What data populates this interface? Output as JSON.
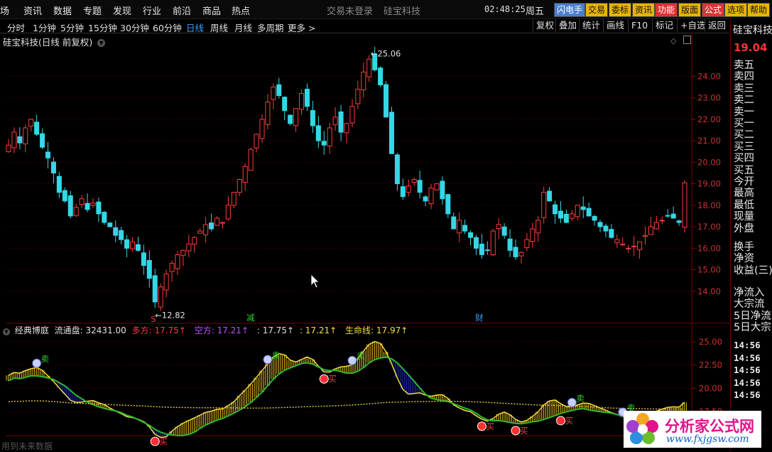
{
  "menubar": {
    "items": [
      "场",
      "资讯",
      "数据",
      "专题",
      "发现",
      "行业",
      "前沿",
      "商品",
      "热点"
    ],
    "center": [
      "交易未登录",
      "硅宝科技"
    ],
    "clock": "02:48:25",
    "weekday": "周五",
    "tabs": [
      {
        "label": "闪电手",
        "bg": "#4a7fd0",
        "fg": "#ffffff"
      },
      {
        "label": "交易",
        "bg": "#e8b400",
        "fg": "#111111"
      },
      {
        "label": "委标",
        "bg": "#e8b400",
        "fg": "#111111"
      },
      {
        "label": "资讯",
        "bg": "#e8b400",
        "fg": "#111111"
      },
      {
        "label": "功能",
        "bg": "#d33",
        "fg": "#ffffff"
      },
      {
        "label": "版面",
        "bg": "#e8b400",
        "fg": "#111111"
      },
      {
        "label": "公式",
        "bg": "#d33",
        "fg": "#ffffff"
      },
      {
        "label": "选项",
        "bg": "#e8b400",
        "fg": "#111111"
      },
      {
        "label": "帮助",
        "bg": "#e8b400",
        "fg": "#111111"
      }
    ]
  },
  "periods": {
    "items": [
      "分时",
      "1分钟",
      "5分钟",
      "15分钟",
      "30分钟",
      "60分钟",
      "日线",
      "周线",
      "月线",
      "多周期",
      "更多 >"
    ],
    "active": "日线"
  },
  "tools": [
    "复权",
    "叠加",
    "统计",
    "画线",
    "F10",
    "标记",
    "+自选",
    "返回"
  ],
  "chart_title": "硅宝科技(日线 前复权)",
  "right_panel": {
    "stock": "硅宝科技",
    "price": "19.04",
    "rows": [
      "卖五",
      "卖四",
      "卖三",
      "卖二",
      "卖一",
      "买一",
      "买二",
      "买三",
      "买四",
      "买五",
      "今开",
      "最高",
      "最低",
      "现量",
      "外盘",
      "换手",
      "净资",
      "收益(三)",
      "净流入",
      "大宗流",
      "5日净流",
      "5日大宗"
    ],
    "times": [
      "14:56",
      "14:56",
      "14:56",
      "14:56",
      "14:56"
    ]
  },
  "indicator": {
    "name": "经典博庭",
    "float_label": "流通盘: 32431.00",
    "duo_label": "多方: 17.75↑",
    "kong_label": "空方: 17.21↑",
    "v3_label": ": 17.75↑",
    "v4_label": ": 17.21↑",
    "life_label": "生命线: 17.97↑"
  },
  "status": "用到未来数据",
  "colors": {
    "up": "#ff3b3b",
    "down": "#35d7e6",
    "grid": "#550000",
    "yellow": "#f0e040",
    "green": "#2fb82f",
    "blue": "#2030c0"
  },
  "chart_data": {
    "type": "candlestick",
    "title": "硅宝科技(日线 前复权)",
    "main_ylim": [
      13.0,
      25.5
    ],
    "main_yticks": [
      14.0,
      15.0,
      16.0,
      17.0,
      18.0,
      19.0,
      20.0,
      21.0,
      22.0,
      23.0,
      24.0
    ],
    "annotations": [
      {
        "label": "25.06",
        "type": "high"
      },
      {
        "label": "12.82",
        "type": "low"
      },
      {
        "label": "减",
        "type": "event"
      },
      {
        "label": "财",
        "type": "event"
      },
      {
        "label": "S",
        "type": "signal"
      }
    ],
    "closes": [
      20.8,
      21.4,
      20.9,
      21.6,
      22.0,
      21.3,
      20.7,
      20.2,
      19.5,
      18.6,
      18.2,
      17.5,
      17.9,
      18.3,
      17.8,
      18.1,
      17.6,
      17.2,
      17.0,
      16.6,
      16.4,
      16.0,
      16.3,
      15.9,
      15.2,
      14.6,
      13.5,
      14.2,
      14.8,
      15.3,
      15.7,
      15.9,
      16.2,
      16.5,
      16.8,
      17.1,
      16.9,
      17.4,
      17.2,
      18.0,
      18.6,
      19.2,
      19.8,
      20.6,
      21.3,
      22.0,
      22.8,
      23.5,
      23.1,
      22.4,
      21.8,
      22.5,
      23.2,
      22.6,
      21.7,
      21.0,
      20.8,
      21.6,
      22.1,
      21.4,
      21.8,
      22.6,
      23.4,
      24.2,
      24.8,
      24.3,
      23.6,
      22.1,
      20.4,
      19.0,
      18.4,
      18.9,
      19.2,
      18.6,
      18.2,
      18.8,
      19.0,
      18.3,
      17.6,
      16.9,
      17.3,
      16.8,
      16.5,
      16.0,
      15.7,
      15.9,
      16.8,
      17.1,
      16.6,
      15.9,
      15.6,
      15.8,
      16.4,
      16.9,
      17.3,
      18.6,
      18.2,
      17.6,
      17.4,
      17.2,
      17.6,
      18.0,
      17.8,
      17.5,
      17.3,
      17.0,
      16.8,
      16.5,
      16.4,
      16.2,
      16.0,
      16.1,
      16.3,
      16.6,
      17.0,
      17.2,
      17.3,
      17.5,
      17.4,
      17.2,
      19.04
    ],
    "indicator_ylim": [
      15.5,
      26.0
    ],
    "indicator_yticks": [
      17.5,
      20.0,
      22.5,
      25.0
    ],
    "life_line": 17.97,
    "duo": 17.75,
    "kong": 17.21
  }
}
